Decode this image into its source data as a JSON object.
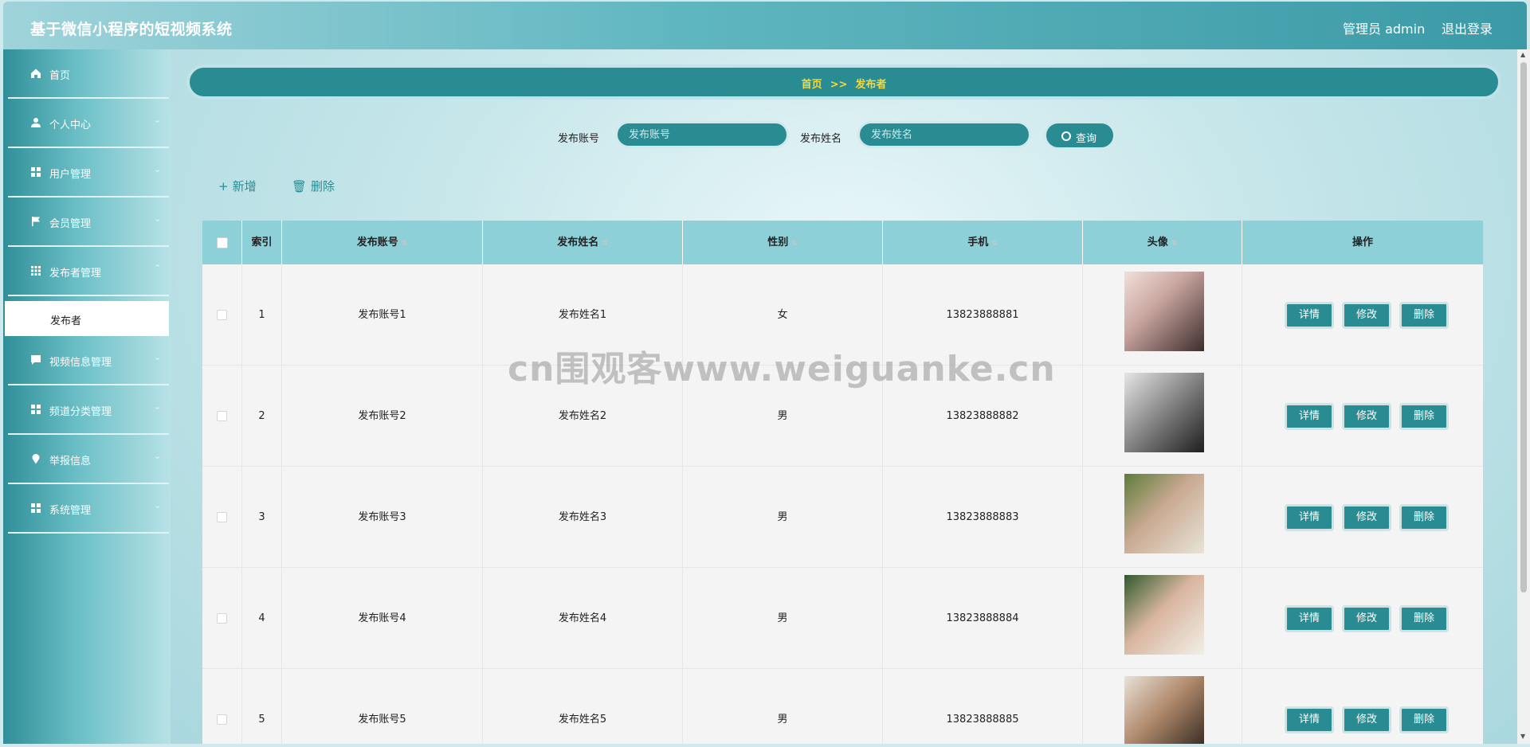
{
  "app": {
    "title": "基于微信小程序的短视频系统"
  },
  "header": {
    "user_label": "管理员 admin",
    "logout_label": "退出登录"
  },
  "sidebar": {
    "items": [
      {
        "label": "首页",
        "icon": "home-icon",
        "has_chevron": false
      },
      {
        "label": "个人中心",
        "icon": "person-icon",
        "has_chevron": true
      },
      {
        "label": "用户管理",
        "icon": "grid-icon",
        "has_chevron": true
      },
      {
        "label": "会员管理",
        "icon": "flag-icon",
        "has_chevron": true
      },
      {
        "label": "发布者管理",
        "icon": "apps-icon",
        "has_chevron": true
      },
      {
        "label": "视频信息管理",
        "icon": "chat-icon",
        "has_chevron": true
      },
      {
        "label": "频道分类管理",
        "icon": "grid-icon",
        "has_chevron": true
      },
      {
        "label": "举报信息",
        "icon": "pin-icon",
        "has_chevron": true
      },
      {
        "label": "系统管理",
        "icon": "grid-icon",
        "has_chevron": true
      }
    ],
    "active_subitem": "发布者"
  },
  "breadcrumb": {
    "home": "首页",
    "separator": ">>",
    "current": "发布者"
  },
  "search": {
    "account_label": "发布账号",
    "account_placeholder": "发布账号",
    "name_label": "发布姓名",
    "name_placeholder": "发布姓名",
    "button_label": "查询"
  },
  "actions": {
    "add_label": "新增",
    "delete_label": "删除"
  },
  "table": {
    "headers": [
      "索引",
      "发布账号",
      "发布姓名",
      "性别",
      "手机",
      "头像",
      "操作"
    ],
    "rows": [
      {
        "index": "1",
        "account": "发布账号1",
        "name": "发布姓名1",
        "gender": "女",
        "phone": "13823888881"
      },
      {
        "index": "2",
        "account": "发布账号2",
        "name": "发布姓名2",
        "gender": "男",
        "phone": "13823888882"
      },
      {
        "index": "3",
        "account": "发布账号3",
        "name": "发布姓名3",
        "gender": "男",
        "phone": "13823888883"
      },
      {
        "index": "4",
        "account": "发布账号4",
        "name": "发布姓名4",
        "gender": "男",
        "phone": "13823888884"
      },
      {
        "index": "5",
        "account": "发布账号5",
        "name": "发布姓名5",
        "gender": "男",
        "phone": "13823888885"
      }
    ],
    "row_actions": {
      "detail": "详情",
      "edit": "修改",
      "delete": "删除"
    }
  },
  "watermark": "cn围观客www.weiguanke.cn",
  "colors": {
    "primary": "#2a8c93",
    "header_row": "#8ed0d8",
    "breadcrumb_text": "#f7d83b"
  }
}
